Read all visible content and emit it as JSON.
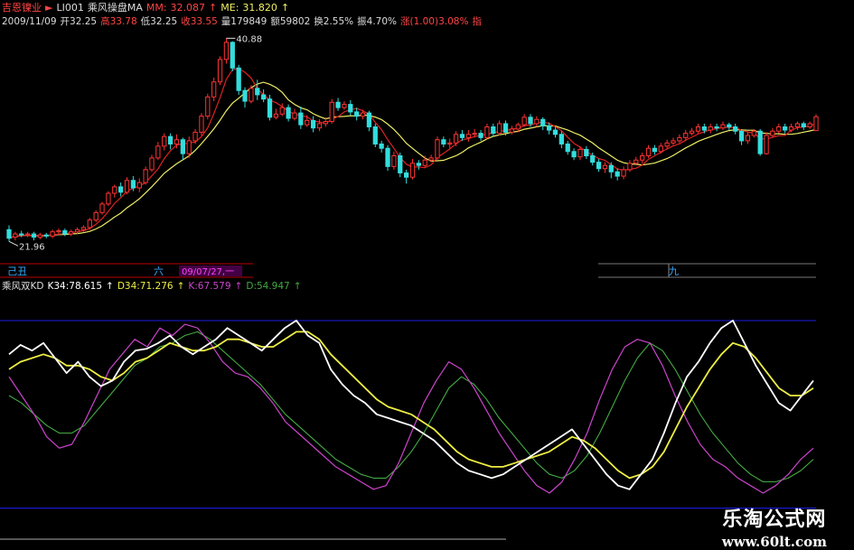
{
  "header_row1": {
    "stock_name": "吉恩镍业",
    "code": "LI001",
    "indicator": "乘风操盘MA",
    "mm_label": "MM:",
    "mm_value": "32.087",
    "me_label": "ME:",
    "me_value": "31.820"
  },
  "header_row2": {
    "date": "2009/11/09",
    "open": "开32.25",
    "high": "高33.78",
    "low": "低32.25",
    "close": "收33.55",
    "volume": "量179849",
    "amount": "额59802",
    "turnover": "换2.55%",
    "amplitude": "振4.70%",
    "change": "涨(1.00)3.08%",
    "extra": "指"
  },
  "annotations": {
    "high_label": "40.88",
    "low_label": "21.96"
  },
  "time_axis": {
    "label_a": "己丑",
    "label_b": "六",
    "date_marker": "09/07/27,一",
    "label_c": "九"
  },
  "kd_header": {
    "name": "乘风双KD",
    "k34": "K34:78.615",
    "d34": "D34:71.276",
    "k": "K:67.579",
    "d": "D:54.947"
  },
  "watermark": {
    "cn": "乐淘公式网",
    "url": "www.60lt.com"
  },
  "colors": {
    "up": "#ff3333",
    "down": "#33dddd",
    "ma_fast": "#dd2222",
    "ma_slow": "#eeee66",
    "k34": "#ffffff",
    "d34": "#eeee44",
    "k": "#cc44cc",
    "d": "#44aa44",
    "band": "#1a1acc",
    "axis": "#bb0000",
    "header_red": "#ff4444",
    "header_cyan": "#33dddd"
  },
  "chart_data": [
    {
      "type": "candlestick",
      "series_labels": [
        "MM",
        "ME"
      ],
      "candles": [
        [
          23.0,
          22.2,
          23.4,
          21.9
        ],
        [
          22.3,
          22.6,
          22.8,
          22.0
        ],
        [
          22.6,
          22.5,
          22.9,
          22.3
        ],
        [
          22.5,
          22.6,
          22.8,
          22.3
        ],
        [
          22.6,
          22.3,
          22.8,
          22.0
        ],
        [
          22.3,
          22.5,
          22.7,
          22.1
        ],
        [
          22.5,
          22.4,
          22.7,
          22.2
        ],
        [
          22.4,
          22.8,
          23.0,
          22.2
        ],
        [
          22.8,
          22.9,
          23.1,
          22.6
        ],
        [
          22.9,
          22.6,
          23.1,
          22.4
        ],
        [
          22.6,
          22.8,
          23.0,
          22.4
        ],
        [
          22.8,
          23.0,
          23.2,
          22.6
        ],
        [
          23.0,
          23.2,
          23.4,
          22.8
        ],
        [
          23.2,
          23.9,
          24.1,
          23.0
        ],
        [
          23.9,
          24.6,
          24.8,
          23.7
        ],
        [
          24.6,
          25.4,
          25.6,
          24.4
        ],
        [
          25.4,
          26.4,
          26.6,
          25.2
        ],
        [
          26.4,
          27.0,
          27.2,
          26.0
        ],
        [
          27.0,
          26.5,
          27.4,
          26.1
        ],
        [
          26.5,
          27.6,
          27.9,
          26.3
        ],
        [
          27.6,
          26.9,
          28.0,
          26.6
        ],
        [
          26.9,
          27.4,
          27.8,
          26.5
        ],
        [
          27.4,
          28.6,
          28.9,
          27.2
        ],
        [
          28.6,
          29.7,
          30.0,
          28.4
        ],
        [
          29.7,
          30.8,
          31.2,
          29.5
        ],
        [
          30.8,
          31.7,
          32.0,
          30.4
        ],
        [
          31.7,
          31.0,
          32.0,
          30.5
        ],
        [
          31.0,
          31.4,
          31.9,
          30.6
        ],
        [
          31.4,
          30.1,
          31.6,
          29.5
        ],
        [
          30.1,
          31.3,
          31.7,
          29.7
        ],
        [
          31.3,
          32.1,
          32.4,
          31.0
        ],
        [
          32.1,
          33.6,
          33.9,
          31.8
        ],
        [
          33.6,
          35.4,
          35.7,
          33.3
        ],
        [
          35.4,
          36.8,
          37.2,
          35.0
        ],
        [
          36.8,
          38.9,
          39.2,
          36.5
        ],
        [
          38.9,
          40.5,
          40.88,
          38.5
        ],
        [
          40.5,
          38.1,
          40.6,
          37.8
        ],
        [
          38.1,
          36.0,
          38.4,
          35.6
        ],
        [
          36.0,
          35.0,
          36.3,
          34.4
        ],
        [
          35.0,
          36.2,
          36.5,
          34.8
        ],
        [
          36.2,
          35.6,
          37.0,
          35.1
        ],
        [
          35.6,
          35.2,
          36.1,
          34.9
        ],
        [
          35.2,
          33.5,
          35.6,
          33.2
        ],
        [
          33.5,
          33.8,
          34.3,
          33.3
        ],
        [
          33.8,
          34.4,
          34.8,
          33.6
        ],
        [
          34.4,
          33.4,
          34.7,
          33.1
        ],
        [
          33.4,
          33.9,
          34.3,
          33.2
        ],
        [
          33.9,
          32.8,
          34.5,
          32.4
        ],
        [
          32.8,
          33.2,
          33.7,
          32.6
        ],
        [
          33.2,
          32.5,
          33.6,
          32.1
        ],
        [
          32.5,
          32.9,
          33.3,
          32.2
        ],
        [
          32.9,
          33.1,
          33.5,
          32.6
        ],
        [
          33.1,
          34.9,
          35.2,
          32.9
        ],
        [
          34.9,
          34.4,
          35.3,
          34.1
        ],
        [
          34.4,
          34.7,
          35.0,
          34.2
        ],
        [
          34.7,
          34.0,
          35.1,
          33.7
        ],
        [
          34.0,
          33.6,
          34.4,
          33.2
        ],
        [
          33.6,
          33.9,
          34.2,
          33.3
        ],
        [
          33.9,
          32.6,
          34.1,
          32.2
        ],
        [
          32.6,
          31.0,
          32.9,
          30.7
        ],
        [
          31.0,
          30.6,
          31.3,
          30.2
        ],
        [
          30.6,
          28.9,
          30.9,
          28.5
        ],
        [
          28.9,
          29.9,
          30.3,
          28.6
        ],
        [
          29.9,
          28.3,
          30.2,
          27.9
        ],
        [
          28.3,
          27.9,
          28.6,
          27.3
        ],
        [
          27.9,
          29.2,
          29.6,
          27.7
        ],
        [
          29.2,
          29.0,
          29.5,
          28.6
        ],
        [
          29.0,
          29.5,
          29.9,
          28.8
        ],
        [
          29.5,
          29.7,
          30.0,
          29.3
        ],
        [
          29.7,
          31.4,
          31.7,
          29.5
        ],
        [
          31.4,
          31.0,
          31.7,
          30.7
        ],
        [
          31.0,
          31.1,
          31.5,
          30.6
        ],
        [
          31.1,
          31.9,
          32.2,
          30.8
        ],
        [
          31.9,
          31.6,
          32.3,
          31.3
        ],
        [
          31.6,
          31.9,
          32.3,
          31.2
        ],
        [
          31.9,
          32.0,
          32.4,
          31.6
        ],
        [
          32.0,
          31.6,
          32.3,
          31.3
        ],
        [
          31.6,
          32.6,
          32.9,
          31.4
        ],
        [
          32.6,
          32.0,
          32.9,
          31.7
        ],
        [
          32.0,
          32.9,
          33.2,
          31.8
        ],
        [
          32.9,
          32.1,
          33.2,
          31.8
        ],
        [
          32.1,
          32.4,
          32.7,
          31.9
        ],
        [
          32.4,
          32.8,
          33.0,
          32.1
        ],
        [
          32.8,
          33.5,
          33.8,
          32.6
        ],
        [
          33.5,
          32.9,
          33.8,
          32.6
        ],
        [
          32.9,
          33.3,
          33.6,
          32.6
        ],
        [
          33.3,
          32.7,
          33.5,
          32.3
        ],
        [
          32.7,
          32.3,
          33.0,
          31.9
        ],
        [
          32.3,
          31.9,
          32.6,
          31.6
        ],
        [
          31.9,
          31.0,
          32.2,
          30.6
        ],
        [
          31.0,
          30.3,
          31.3,
          30.0
        ],
        [
          30.3,
          29.8,
          30.6,
          29.5
        ],
        [
          29.8,
          30.5,
          30.8,
          29.5
        ],
        [
          30.5,
          29.9,
          30.8,
          29.6
        ],
        [
          29.9,
          29.3,
          30.2,
          29.0
        ],
        [
          29.3,
          28.7,
          29.6,
          28.4
        ],
        [
          28.7,
          29.0,
          29.3,
          28.3
        ],
        [
          29.0,
          28.4,
          29.3,
          27.8
        ],
        [
          28.4,
          28.0,
          28.7,
          27.6
        ],
        [
          28.0,
          28.6,
          28.9,
          27.7
        ],
        [
          28.6,
          29.2,
          29.5,
          28.4
        ],
        [
          29.2,
          29.5,
          29.8,
          29.0
        ],
        [
          29.5,
          29.9,
          30.2,
          29.2
        ],
        [
          29.9,
          30.6,
          30.9,
          29.7
        ],
        [
          30.6,
          30.3,
          30.9,
          30.0
        ],
        [
          30.3,
          30.8,
          31.1,
          30.1
        ],
        [
          30.8,
          31.1,
          31.4,
          30.5
        ],
        [
          31.1,
          31.3,
          31.6,
          30.9
        ],
        [
          31.3,
          31.6,
          31.9,
          31.1
        ],
        [
          31.6,
          32.0,
          32.3,
          31.3
        ],
        [
          32.0,
          32.2,
          32.5,
          31.8
        ],
        [
          32.2,
          32.6,
          32.9,
          32.0
        ],
        [
          32.6,
          32.3,
          32.9,
          32.0
        ],
        [
          32.3,
          32.6,
          32.9,
          32.0
        ],
        [
          32.6,
          32.5,
          32.9,
          32.2
        ],
        [
          32.5,
          32.8,
          33.1,
          32.3
        ],
        [
          32.8,
          32.6,
          33.0,
          32.3
        ],
        [
          32.6,
          32.2,
          32.9,
          31.9
        ],
        [
          32.2,
          31.3,
          32.4,
          30.9
        ],
        [
          31.3,
          31.8,
          32.1,
          31.0
        ],
        [
          31.8,
          32.2,
          32.4,
          31.6
        ],
        [
          32.2,
          30.1,
          32.4,
          29.9
        ],
        [
          30.1,
          31.8,
          32.1,
          30.0
        ],
        [
          31.8,
          32.2,
          32.5,
          31.6
        ],
        [
          32.2,
          32.6,
          32.9,
          32.0
        ],
        [
          32.6,
          32.3,
          32.9,
          32.0
        ],
        [
          32.3,
          32.6,
          32.9,
          32.1
        ],
        [
          32.6,
          32.9,
          33.1,
          32.3
        ],
        [
          32.9,
          32.6,
          33.1,
          32.3
        ],
        [
          32.6,
          32.9,
          33.1,
          32.4
        ],
        [
          32.25,
          33.55,
          33.78,
          32.25
        ]
      ]
    },
    {
      "type": "line",
      "series": [
        {
          "name": "K34",
          "values": [
            82,
            87,
            84,
            88,
            80,
            72,
            78,
            70,
            65,
            68,
            78,
            84,
            85,
            88,
            92,
            86,
            82,
            86,
            90,
            96,
            92,
            88,
            84,
            90,
            96,
            100,
            92,
            88,
            74,
            66,
            60,
            56,
            50,
            48,
            46,
            44,
            40,
            36,
            30,
            24,
            20,
            18,
            16,
            18,
            22,
            26,
            30,
            34,
            38,
            42,
            34,
            26,
            18,
            12,
            10,
            18,
            26,
            40,
            56,
            70,
            78,
            88,
            96,
            100,
            88,
            76,
            66,
            56,
            52,
            60,
            68
          ]
        },
        {
          "name": "D34",
          "values": [
            74,
            78,
            80,
            82,
            80,
            76,
            76,
            74,
            70,
            68,
            72,
            78,
            80,
            84,
            88,
            86,
            84,
            84,
            86,
            90,
            90,
            88,
            86,
            86,
            90,
            94,
            94,
            90,
            82,
            76,
            70,
            64,
            58,
            54,
            52,
            50,
            46,
            42,
            36,
            30,
            26,
            24,
            22,
            22,
            24,
            26,
            28,
            30,
            34,
            38,
            36,
            32,
            26,
            20,
            16,
            18,
            22,
            30,
            42,
            54,
            64,
            74,
            82,
            88,
            86,
            80,
            72,
            64,
            60,
            60,
            64
          ]
        },
        {
          "name": "K",
          "values": [
            70,
            60,
            50,
            38,
            32,
            34,
            46,
            60,
            74,
            82,
            90,
            86,
            96,
            92,
            98,
            96,
            88,
            78,
            72,
            70,
            64,
            56,
            46,
            40,
            34,
            28,
            22,
            18,
            14,
            10,
            12,
            24,
            40,
            56,
            68,
            78,
            74,
            64,
            52,
            40,
            30,
            20,
            12,
            8,
            14,
            26,
            40,
            58,
            74,
            86,
            90,
            88,
            76,
            60,
            46,
            34,
            26,
            22,
            16,
            12,
            8,
            12,
            18,
            26,
            32
          ]
        },
        {
          "name": "D",
          "values": [
            60,
            56,
            50,
            44,
            40,
            40,
            44,
            52,
            60,
            68,
            76,
            80,
            86,
            88,
            92,
            94,
            90,
            84,
            78,
            72,
            66,
            58,
            50,
            44,
            38,
            32,
            26,
            22,
            18,
            16,
            16,
            22,
            30,
            40,
            52,
            64,
            70,
            66,
            58,
            48,
            40,
            32,
            24,
            18,
            16,
            20,
            28,
            40,
            54,
            68,
            80,
            88,
            84,
            74,
            62,
            50,
            40,
            32,
            24,
            18,
            14,
            14,
            16,
            20,
            26
          ]
        }
      ],
      "bands": [
        100,
        0
      ]
    }
  ]
}
